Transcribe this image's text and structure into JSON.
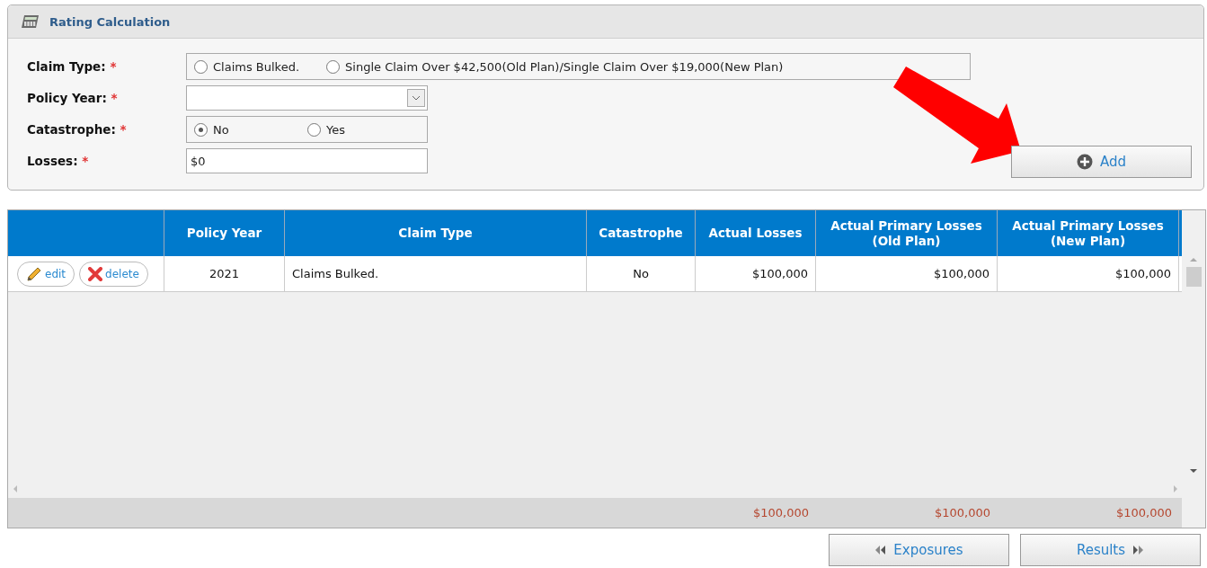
{
  "panel": {
    "title": "Rating Calculation"
  },
  "fields": [
    {
      "kind": "radio",
      "label": "Claim Type:",
      "required": "*",
      "options": [
        {
          "label": "Claims Bulked.",
          "selected": false
        },
        {
          "label": "Single Claim Over $42,500(Old Plan)/Single Claim Over $19,000(New Plan)",
          "selected": false
        }
      ]
    },
    {
      "kind": "select",
      "label": "Policy Year:",
      "required": "*"
    },
    {
      "kind": "radio",
      "label": "Catastrophe:",
      "required": "*",
      "options": [
        {
          "label": "No",
          "selected": true
        },
        {
          "label": "Yes",
          "selected": false
        }
      ]
    },
    {
      "kind": "text",
      "label": "Losses:",
      "required": "*",
      "value": "$0"
    }
  ],
  "add_button": "Add",
  "grid": {
    "columns": [
      "Policy Year",
      "Claim Type",
      "Catastrophe",
      "Actual Losses",
      "Actual Primary Losses (Old Plan)",
      "Actual Primary Losses (New Plan)"
    ],
    "rows": [
      {
        "edit": "edit",
        "delete": "delete",
        "cells": [
          "2021",
          "Claims Bulked.",
          "No",
          "$100,000",
          "$100,000",
          "$100,000"
        ]
      }
    ],
    "totals": [
      "$100,000",
      "$100,000",
      "$100,000"
    ]
  },
  "nav": {
    "back": "Exposures",
    "next": "Results"
  }
}
